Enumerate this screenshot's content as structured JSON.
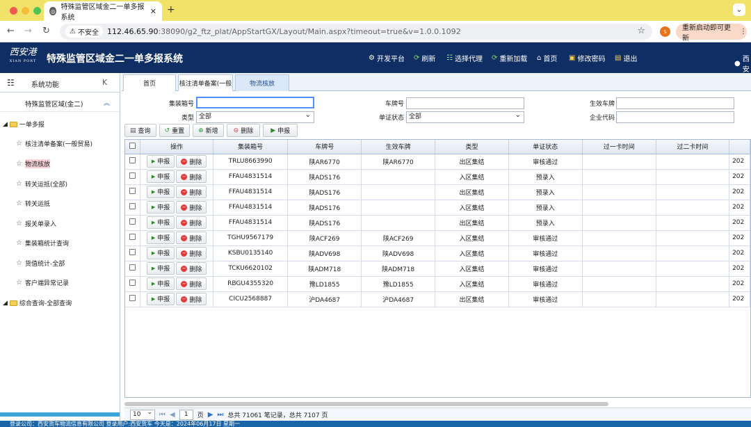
{
  "browser": {
    "tab_title": "特殊监管区域金二一单多报系统",
    "tab_favicon": "globe-icon",
    "new_tab": "+",
    "security_label": "不安全",
    "url_host": "112.46.65.90",
    "url_rest": ":38090/g2_ftz_plat/AppStartGX/Layout/Main.aspx?timeout=true&v=1.0.0.1092",
    "profile_initial": "S",
    "relaunch_label": "重新启动即可更新"
  },
  "app": {
    "logo_text": "西安港",
    "logo_sub": "XIAN PORT",
    "title": "特殊监管区域金二一单多报系统",
    "nav": [
      {
        "label": "开发平台",
        "icon": "gear-icon"
      },
      {
        "label": "刷新",
        "icon": "refresh-icon"
      },
      {
        "label": "选择代理",
        "icon": "tree-icon"
      },
      {
        "label": "重新加载",
        "icon": "reload-icon"
      },
      {
        "label": "首页",
        "icon": "home-icon"
      },
      {
        "label": "修改密码",
        "icon": "key-icon"
      },
      {
        "label": "退出",
        "icon": "exit-icon"
      }
    ],
    "user_partial": "西安"
  },
  "sidebar": {
    "header": "系统功能",
    "collapse": "K",
    "region": "特殊监管区域(金二)",
    "folder1": "一单多报",
    "items": [
      "核注清单备案(一般贸易)",
      "物流核放",
      "转关运抵(全部)",
      "转关运抵",
      "报关单录入",
      "集装箱统计查询",
      "货值统计-全部",
      "客户端异常记录"
    ],
    "folder2": "综合查询-全部查询"
  },
  "tabs": [
    "首页",
    "核注清单备案(一般",
    "物流核放"
  ],
  "form": {
    "container_label": "集装箱号",
    "container_value": "",
    "plate_label": "车牌号",
    "plate_value": "",
    "effective_plate_label": "生效车牌",
    "effective_plate_value": "",
    "type_label": "类型",
    "type_value": "全部",
    "status_label": "单证状态",
    "status_value": "全部",
    "company_label": "企业代码",
    "company_value": ""
  },
  "buttons": {
    "query": "查询",
    "reset": "重置",
    "add": "新增",
    "delete": "删除",
    "declare": "申报"
  },
  "table": {
    "headers": [
      "操作",
      "集装箱号",
      "车牌号",
      "生效车牌",
      "类型",
      "单证状态",
      "过一卡时间",
      "过二卡时间",
      ""
    ],
    "row_declare": "申报",
    "row_delete": "删除",
    "rows": [
      {
        "container": "TRLU8663990",
        "plate": "陕AR6770",
        "eff": "陕AR6770",
        "type": "出区集结",
        "status": "审核通过",
        "t1": "",
        "t2": "",
        "extra": "202"
      },
      {
        "container": "FFAU4831514",
        "plate": "陕ADS176",
        "eff": "",
        "type": "入区集结",
        "status": "预录入",
        "t1": "",
        "t2": "",
        "extra": "202"
      },
      {
        "container": "FFAU4831514",
        "plate": "陕ADS176",
        "eff": "",
        "type": "出区集结",
        "status": "预录入",
        "t1": "",
        "t2": "",
        "extra": "202"
      },
      {
        "container": "FFAU4831514",
        "plate": "陕ADS176",
        "eff": "",
        "type": "入区集结",
        "status": "预录入",
        "t1": "",
        "t2": "",
        "extra": "202"
      },
      {
        "container": "FFAU4831514",
        "plate": "陕ADS176",
        "eff": "",
        "type": "出区集结",
        "status": "预录入",
        "t1": "",
        "t2": "",
        "extra": "202"
      },
      {
        "container": "TGHU9567179",
        "plate": "陕ACF269",
        "eff": "陕ACF269",
        "type": "入区集结",
        "status": "审核通过",
        "t1": "",
        "t2": "",
        "extra": "202"
      },
      {
        "container": "KSBU0135140",
        "plate": "陕ADV698",
        "eff": "陕ADV698",
        "type": "入区集结",
        "status": "审核通过",
        "t1": "",
        "t2": "",
        "extra": "202"
      },
      {
        "container": "TCKU6620102",
        "plate": "陕ADM718",
        "eff": "陕ADM718",
        "type": "入区集结",
        "status": "审核通过",
        "t1": "",
        "t2": "",
        "extra": "202"
      },
      {
        "container": "RBGU4355320",
        "plate": "豫LD1855",
        "eff": "豫LD1855",
        "type": "入区集结",
        "status": "审核通过",
        "t1": "",
        "t2": "",
        "extra": "202"
      },
      {
        "container": "CICU2568887",
        "plate": "沪DA4687",
        "eff": "沪DA4687",
        "type": "出区集结",
        "status": "审核通过",
        "t1": "",
        "t2": "",
        "extra": "202"
      }
    ]
  },
  "pager": {
    "page_size": "10",
    "current_page": "1",
    "page_suffix": "页",
    "summary": "总共 71061 笔记录，总共 7107 页"
  },
  "status_bar": "登录公司：西安货车物流信息有限公司 登录用户:西安货车 今天是：2024年06月17日 星期一"
}
